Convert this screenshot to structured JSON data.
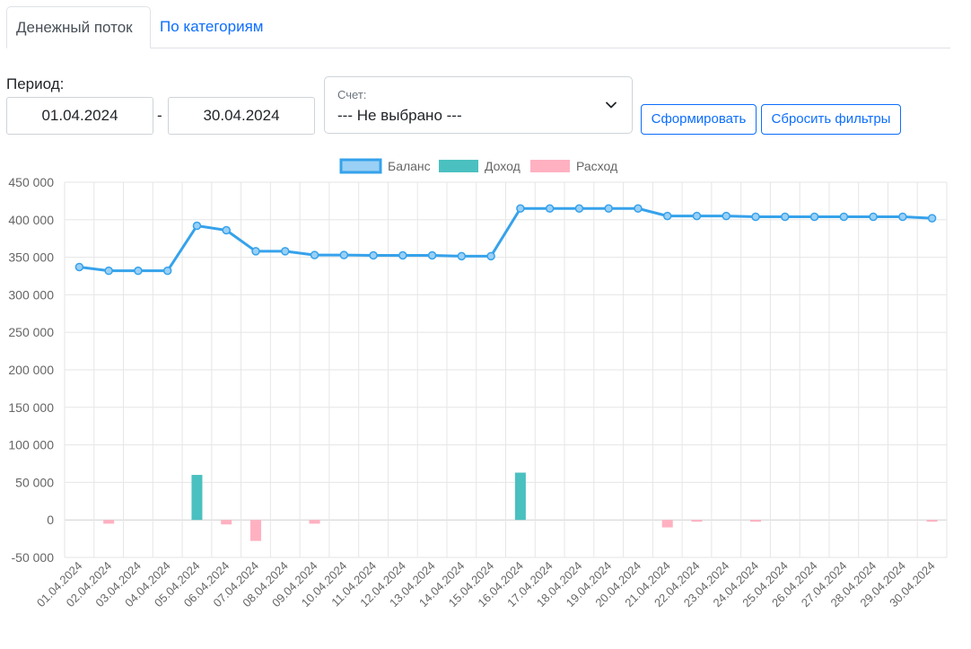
{
  "tabs": [
    {
      "label": "Денежный поток",
      "active": true
    },
    {
      "label": "По категориям",
      "active": false
    }
  ],
  "filters": {
    "period_label": "Период:",
    "date_from": "01.04.2024",
    "separator": "-",
    "date_to": "30.04.2024",
    "account_label": "Счет:",
    "account_value": "--- Не выбрано ---",
    "account_icon": "chevron-down-icon",
    "submit_label": "Сформировать",
    "reset_label": "Сбросить фильтры"
  },
  "colors": {
    "accent": "#0d6efd",
    "balance": "#36a2eb",
    "income": "#4bc0c0",
    "expense": "#ffb1c1"
  },
  "chart_data": {
    "type": "bar",
    "legend_position": "top",
    "grid": true,
    "ylim": [
      -50000,
      450000
    ],
    "y_ticks": [
      "450 000",
      "400 000",
      "350 000",
      "300 000",
      "250 000",
      "200 000",
      "150 000",
      "100 000",
      "50 000",
      "0",
      "-50 000"
    ],
    "categories": [
      "01.04.2024",
      "02.04.2024",
      "03.04.2024",
      "04.04.2024",
      "05.04.2024",
      "06.04.2024",
      "07.04.2024",
      "08.04.2024",
      "09.04.2024",
      "10.04.2024",
      "11.04.2024",
      "12.04.2024",
      "13.04.2024",
      "14.04.2024",
      "15.04.2024",
      "16.04.2024",
      "17.04.2024",
      "18.04.2024",
      "19.04.2024",
      "20.04.2024",
      "21.04.2024",
      "22.04.2024",
      "23.04.2024",
      "24.04.2024",
      "25.04.2024",
      "26.04.2024",
      "27.04.2024",
      "28.04.2024",
      "29.04.2024",
      "30.04.2024"
    ],
    "series": [
      {
        "name": "Баланс",
        "type": "line",
        "values": [
          337000,
          332000,
          332000,
          332000,
          392000,
          386000,
          358000,
          358000,
          353000,
          353000,
          352500,
          352500,
          352500,
          351500,
          351500,
          415000,
          415000,
          415000,
          415000,
          415000,
          405000,
          405000,
          405000,
          404000,
          404000,
          404000,
          404000,
          404000,
          404000,
          402000
        ]
      },
      {
        "name": "Доход",
        "type": "bar",
        "values": [
          0,
          0,
          0,
          0,
          60000,
          0,
          0,
          0,
          0,
          0,
          0,
          0,
          0,
          0,
          0,
          63000,
          0,
          0,
          0,
          0,
          0,
          0,
          0,
          0,
          0,
          0,
          0,
          0,
          0,
          0
        ]
      },
      {
        "name": "Расход",
        "type": "bar",
        "values": [
          0,
          -5000,
          0,
          0,
          0,
          -6000,
          -28000,
          0,
          -5000,
          0,
          0,
          0,
          0,
          0,
          0,
          0,
          0,
          0,
          0,
          0,
          -10000,
          -1000,
          0,
          -2000,
          0,
          0,
          0,
          0,
          0,
          -2000
        ]
      }
    ]
  }
}
